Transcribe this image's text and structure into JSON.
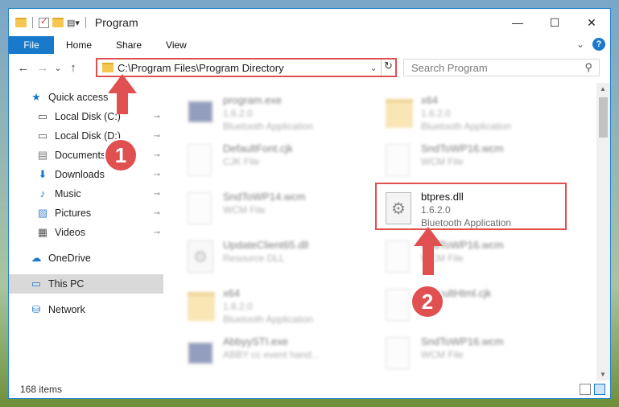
{
  "window": {
    "title": "Program",
    "controls": {
      "minimize": "—",
      "maximize": "☐",
      "close": "✕"
    }
  },
  "ribbon": {
    "tabs": [
      "File",
      "Home",
      "Share",
      "View"
    ],
    "collapse": "⌄",
    "help": "?"
  },
  "navbar": {
    "back": "←",
    "forward": "→",
    "recent": "⌄",
    "up": "↑",
    "address": "C:\\Program Files\\Program Directory",
    "address_dropdown": "⌄",
    "refresh": "↻",
    "search_placeholder": "Search Program",
    "search_icon": "⚲"
  },
  "sidebar": {
    "items": [
      {
        "label": "Quick access",
        "icon": "star-icon",
        "pinned": false
      },
      {
        "label": "Local Disk (C:)",
        "icon": "drive-icon",
        "pinned": true
      },
      {
        "label": "Local Disk (D:)",
        "icon": "drive-icon",
        "pinned": true
      },
      {
        "label": "Documents",
        "icon": "documents-icon",
        "pinned": true
      },
      {
        "label": "Downloads",
        "icon": "download-icon",
        "pinned": true
      },
      {
        "label": "Music",
        "icon": "music-icon",
        "pinned": true
      },
      {
        "label": "Pictures",
        "icon": "pictures-icon",
        "pinned": true
      },
      {
        "label": "Videos",
        "icon": "videos-icon",
        "pinned": true
      },
      {
        "label": "OneDrive",
        "icon": "cloud-icon",
        "pinned": false
      },
      {
        "label": "This PC",
        "icon": "computer-icon",
        "pinned": false,
        "selected": true
      },
      {
        "label": "Network",
        "icon": "network-icon",
        "pinned": false
      }
    ],
    "pin_glyph": "📌"
  },
  "files": [
    {
      "name": "program.exe",
      "line2": "1.6.2.0",
      "line3": "Bluetooth Application",
      "kind": "exe",
      "blurred": true
    },
    {
      "name": "x64",
      "line2": "1.6.2.0",
      "line3": "Bluetooth Application",
      "kind": "folder",
      "blurred": true
    },
    {
      "name": "DefaultFont.cjk",
      "line2": "CJK File",
      "line3": "",
      "kind": "doc",
      "blurred": true
    },
    {
      "name": "SndToWP16.wcm",
      "line2": "WCM File",
      "line3": "",
      "kind": "doc",
      "blurred": true
    },
    {
      "name": "SndToWP14.wcm",
      "line2": "WCM File",
      "line3": "",
      "kind": "doc",
      "blurred": true
    },
    {
      "name": "btpres.dll",
      "line2": "1.6.2.0",
      "line3": "Bluetooth Application",
      "kind": "dll",
      "blurred": false
    },
    {
      "name": "UpdateClient65.dll",
      "line2": "Resource DLL",
      "line3": "",
      "kind": "dll",
      "blurred": true
    },
    {
      "name": "SndToWP16.wcm",
      "line2": "WCM File",
      "line3": "",
      "kind": "doc",
      "blurred": true
    },
    {
      "name": "x64",
      "line2": "1.6.2.0",
      "line3": "Bluetooth Application",
      "kind": "folder",
      "blurred": true
    },
    {
      "name": "DefaultHtml.cjk",
      "line2": "File",
      "line3": "",
      "kind": "doc",
      "blurred": true
    },
    {
      "name": "AbbyySTI.exe",
      "line2": "ABBY cc event hand...",
      "line3": "",
      "kind": "exe",
      "blurred": true
    },
    {
      "name": "SndToWP16.wcm",
      "line2": "WCM File",
      "line3": "",
      "kind": "doc",
      "blurred": true
    }
  ],
  "status": {
    "item_count": "168 items"
  },
  "annotations": {
    "step1": "1",
    "step2": "2",
    "accent": "#e05050"
  }
}
